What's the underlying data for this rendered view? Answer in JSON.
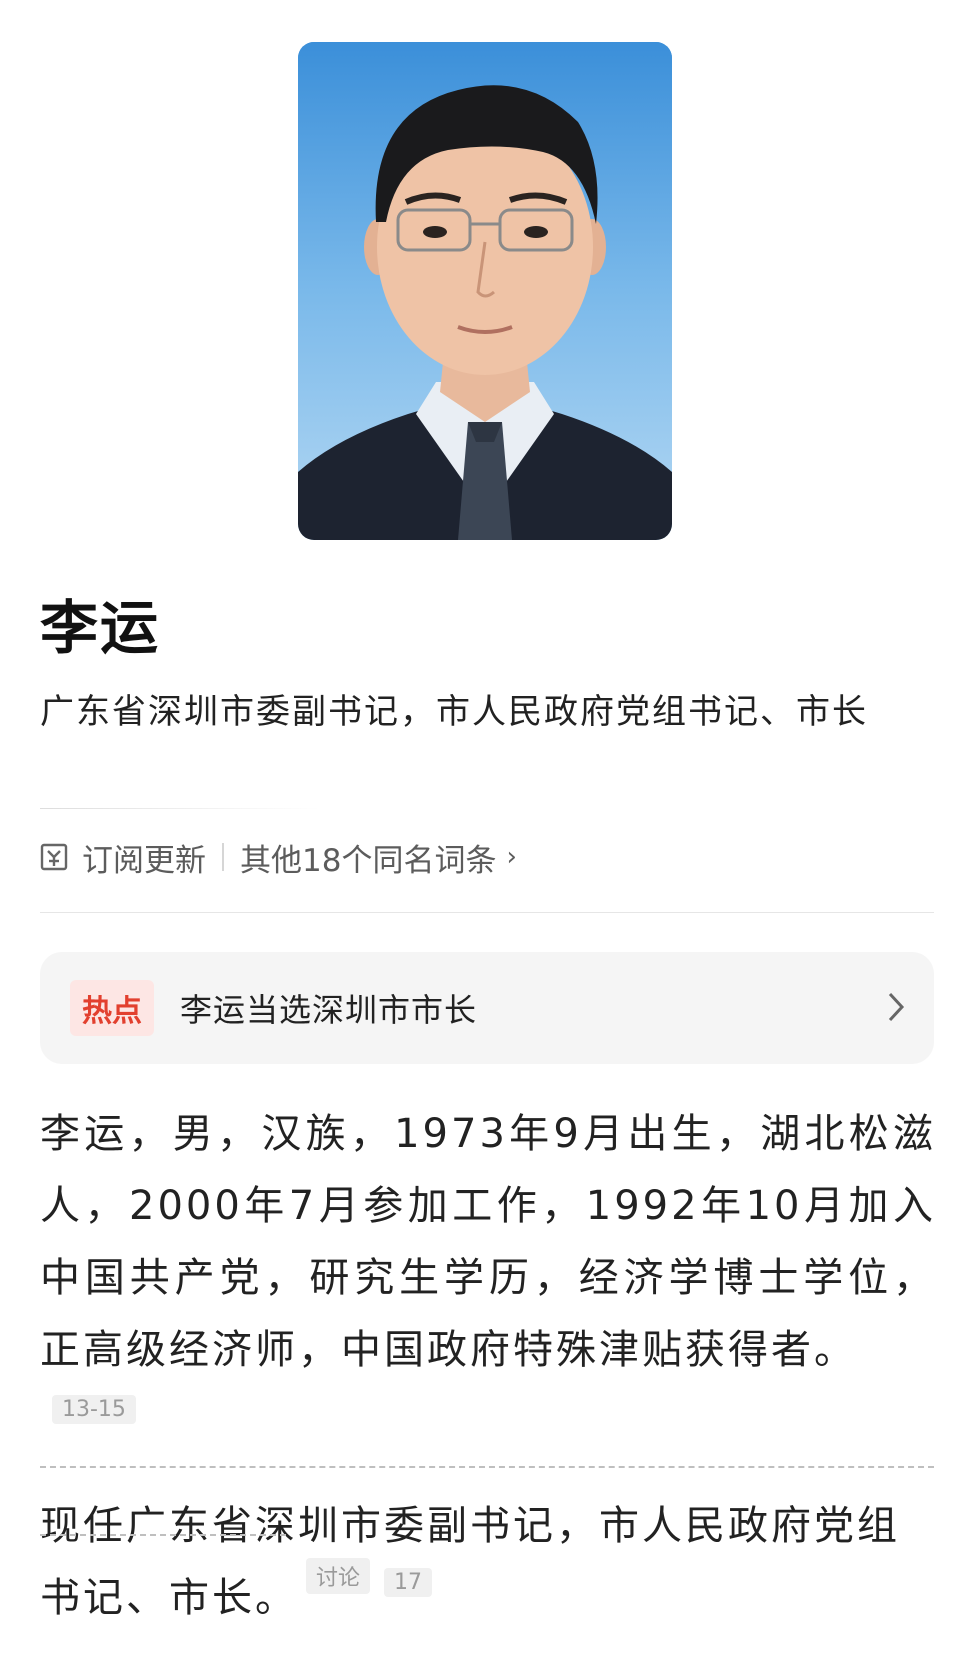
{
  "person": {
    "name": "李运",
    "title": "广东省深圳市委副书记，市人民政府党组书记、市长"
  },
  "actions": {
    "subscribe_label": "订阅更新",
    "same_name_label": "其他18个同名词条"
  },
  "hot": {
    "badge": "热点",
    "headline": "李运当选深圳市市长"
  },
  "bio": {
    "paragraph": "李运，男，汉族，1973年9月出生，湖北松滋人，2000年7月参加工作，1992年10月加入中国共产党，研究生学历，经济学博士学位，正高级经济师，中国政府特殊津贴获得者。",
    "citation": "13-15",
    "current_position": "现任广东省深圳市委副书记，市人民政府党组书记、市长。",
    "discussion_label": "讨论",
    "discussion_count": "17"
  },
  "colors": {
    "hot_badge_bg": "#fde6e4",
    "hot_badge_text": "#e2402f",
    "card_bg": "#f5f5f5"
  }
}
